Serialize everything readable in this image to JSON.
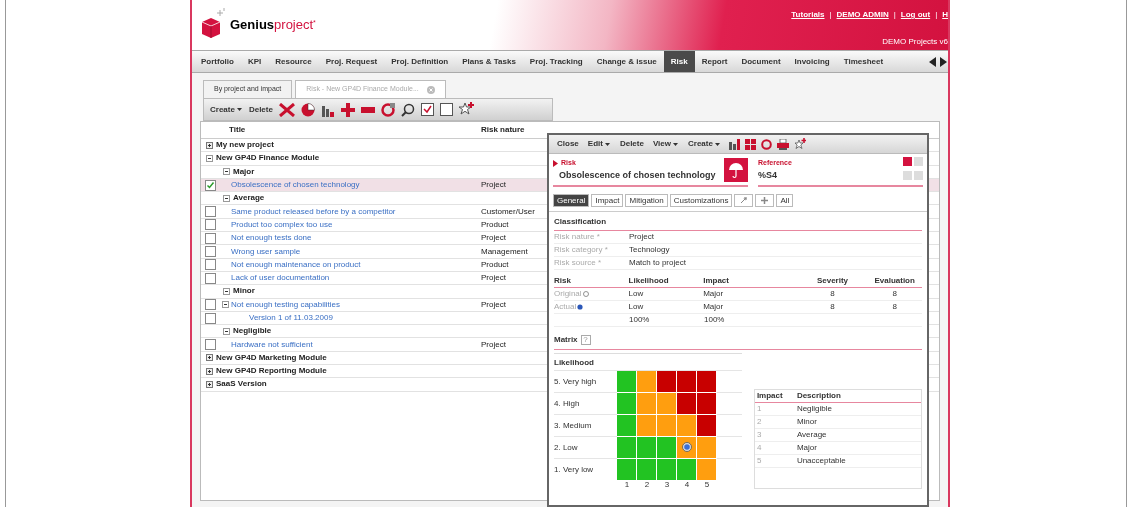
{
  "header": {
    "logo": {
      "brand": "Genius",
      "product": "project",
      "mark": "*"
    },
    "links": [
      {
        "kind": "link",
        "text": "Tutorials"
      },
      {
        "kind": "sep",
        "text": "|"
      },
      {
        "kind": "link",
        "text": "DEMO ADMIN"
      },
      {
        "kind": "sep",
        "text": "|"
      },
      {
        "kind": "link",
        "text": "Log out"
      },
      {
        "kind": "sep",
        "text": "|"
      },
      {
        "kind": "link",
        "text": "H"
      }
    ],
    "subtitle": "DEMO Projects v6"
  },
  "nav": {
    "tabs": [
      {
        "label": "Portfolio",
        "selected": false
      },
      {
        "label": "KPI",
        "selected": false
      },
      {
        "label": "Resource",
        "selected": false
      },
      {
        "label": "Proj. Request",
        "selected": false
      },
      {
        "label": "Proj. Definition",
        "selected": false
      },
      {
        "label": "Plans & Tasks",
        "selected": false
      },
      {
        "label": "Proj. Tracking",
        "selected": false
      },
      {
        "label": "Change & issue",
        "selected": false
      },
      {
        "label": "Risk",
        "selected": true
      },
      {
        "label": "Report",
        "selected": false
      },
      {
        "label": "Document",
        "selected": false
      },
      {
        "label": "Invoicing",
        "selected": false
      },
      {
        "label": "Timesheet",
        "selected": false
      }
    ]
  },
  "page_tabs": [
    {
      "label": "By project and impact",
      "selected": true,
      "closable": false
    },
    {
      "label": "Risk - New GP4D Finance Module...",
      "selected": false,
      "closable": true
    }
  ],
  "toolbar": {
    "buttons": [
      {
        "label": "Create",
        "dropdown": true
      },
      {
        "label": "Delete",
        "dropdown": false
      }
    ]
  },
  "grid": {
    "columns": [
      "Title",
      "Risk nature"
    ],
    "rows": [
      {
        "kind": "project",
        "title": "My new project",
        "expanded": false
      },
      {
        "kind": "project",
        "title": "New GP4D Finance Module",
        "expanded": true,
        "children": [
          {
            "kind": "group",
            "title": "Major",
            "expanded": true,
            "children": [
              {
                "kind": "risk",
                "title": "Obsolescence of chosen technology",
                "nature": "Project",
                "checked": true,
                "selected": true
              }
            ]
          },
          {
            "kind": "group",
            "title": "Average",
            "expanded": true,
            "children": [
              {
                "kind": "risk",
                "title": "Same product released before by a competitor",
                "nature": "Customer/User",
                "checked": false,
                "selected": false
              },
              {
                "kind": "risk",
                "title": "Product too complex too use",
                "nature": "Product",
                "checked": false,
                "selected": false
              },
              {
                "kind": "risk",
                "title": "Not enough tests done",
                "nature": "Project",
                "checked": false,
                "selected": false
              },
              {
                "kind": "risk",
                "title": "Wrong user sample",
                "nature": "Management",
                "checked": false,
                "selected": false
              },
              {
                "kind": "risk",
                "title": "Not enough maintenance on product",
                "nature": "Product",
                "checked": false,
                "selected": false
              },
              {
                "kind": "risk",
                "title": "Lack of user documentation",
                "nature": "Project",
                "checked": false,
                "selected": false
              }
            ]
          },
          {
            "kind": "group",
            "title": "Minor",
            "expanded": true,
            "children": [
              {
                "kind": "risk",
                "title": "Not enough testing capabilities",
                "nature": "Project",
                "checked": false,
                "selected": false,
                "expanded": true,
                "children": [
                  {
                    "kind": "version",
                    "title": "Version 1 of 11.03.2009",
                    "checked": false,
                    "selected": false
                  }
                ]
              }
            ]
          },
          {
            "kind": "group",
            "title": "Negligible",
            "expanded": true,
            "children": [
              {
                "kind": "risk",
                "title": "Hardware not sufficient",
                "nature": "Project",
                "checked": false,
                "selected": false
              }
            ]
          }
        ]
      },
      {
        "kind": "project",
        "title": "New GP4D Marketing Module",
        "expanded": false
      },
      {
        "kind": "project",
        "title": "New GP4D Reporting Module",
        "expanded": false
      },
      {
        "kind": "project",
        "title": "SaaS Version",
        "expanded": false
      }
    ]
  },
  "popup": {
    "toolbar": [
      {
        "label": "Close",
        "dropdown": false
      },
      {
        "label": "Edit",
        "dropdown": true
      },
      {
        "label": "Delete",
        "dropdown": false
      },
      {
        "label": "View",
        "dropdown": true
      },
      {
        "label": "Create",
        "dropdown": true
      }
    ],
    "heading": {
      "label": "Risk",
      "title": "Obsolescence of chosen technology",
      "reference_label": "Reference",
      "reference": "%S4"
    },
    "tabs": [
      {
        "kind": "text",
        "label": "General",
        "selected": true
      },
      {
        "kind": "text",
        "label": "Impact",
        "selected": false
      },
      {
        "kind": "text",
        "label": "Mitigation",
        "selected": false
      },
      {
        "kind": "text",
        "label": "Customizations",
        "selected": false
      },
      {
        "kind": "link-icon",
        "selected": false
      },
      {
        "kind": "puzzle-icon",
        "selected": false
      },
      {
        "kind": "text",
        "label": "All",
        "selected": false
      }
    ],
    "classification": {
      "title": "Classification",
      "fields": [
        {
          "label": "Risk nature *",
          "value": "Project"
        },
        {
          "label": "Risk category *",
          "value": "Technology"
        },
        {
          "label": "Risk source *",
          "value": "Match to project"
        }
      ]
    },
    "risk_table": {
      "columns": [
        "Risk",
        "Likelihood",
        "Impact",
        "Severity",
        "Evaluation"
      ],
      "rows": [
        {
          "kind": "option",
          "selected": false,
          "cells": [
            "Original",
            "Low",
            "Major",
            "8",
            "8"
          ]
        },
        {
          "kind": "option",
          "selected": true,
          "cells": [
            "Actual",
            "Low",
            "Major",
            "8",
            "8"
          ]
        },
        {
          "kind": "total",
          "cells": [
            "",
            "100%",
            "100%"
          ]
        }
      ]
    },
    "matrix": {
      "title": "Matrix",
      "help": "?",
      "y_title": "Likelihood",
      "rows": [
        {
          "label": "5. Very high",
          "cells": [
            {
              "color": "#22c322",
              "selected": false
            },
            {
              "color": "#ff9e0f",
              "selected": false
            },
            {
              "color": "#c80000",
              "selected": false
            },
            {
              "color": "#c80000",
              "selected": false
            },
            {
              "color": "#c80000",
              "selected": false
            }
          ]
        },
        {
          "label": "4. High",
          "cells": [
            {
              "color": "#22c322",
              "selected": false
            },
            {
              "color": "#ff9e0f",
              "selected": false
            },
            {
              "color": "#ff9e0f",
              "selected": false
            },
            {
              "color": "#c80000",
              "selected": false
            },
            {
              "color": "#c80000",
              "selected": false
            }
          ]
        },
        {
          "label": "3. Medium",
          "cells": [
            {
              "color": "#22c322",
              "selected": false
            },
            {
              "color": "#ff9e0f",
              "selected": false
            },
            {
              "color": "#ff9e0f",
              "selected": false
            },
            {
              "color": "#ff9e0f",
              "selected": false
            },
            {
              "color": "#c80000",
              "selected": false
            }
          ]
        },
        {
          "label": "2. Low",
          "cells": [
            {
              "color": "#22c322",
              "selected": false
            },
            {
              "color": "#22c322",
              "selected": false
            },
            {
              "color": "#22c322",
              "selected": false
            },
            {
              "color": "#ff9e0f",
              "selected": true
            },
            {
              "color": "#ff9e0f",
              "selected": false
            }
          ]
        },
        {
          "label": "1. Very low",
          "cells": [
            {
              "color": "#22c322",
              "selected": false
            },
            {
              "color": "#22c322",
              "selected": false
            },
            {
              "color": "#22c322",
              "selected": false
            },
            {
              "color": "#22c322",
              "selected": false
            },
            {
              "color": "#ff9e0f",
              "selected": false
            }
          ]
        }
      ],
      "columns": [
        "1",
        "2",
        "3",
        "4",
        "5"
      ]
    },
    "impact_table": {
      "columns": [
        "Impact",
        "Description"
      ],
      "rows": [
        [
          "1",
          "Negligible"
        ],
        [
          "2",
          "Minor"
        ],
        [
          "3",
          "Average"
        ],
        [
          "4",
          "Major"
        ],
        [
          "5",
          "Unacceptable"
        ]
      ]
    }
  }
}
